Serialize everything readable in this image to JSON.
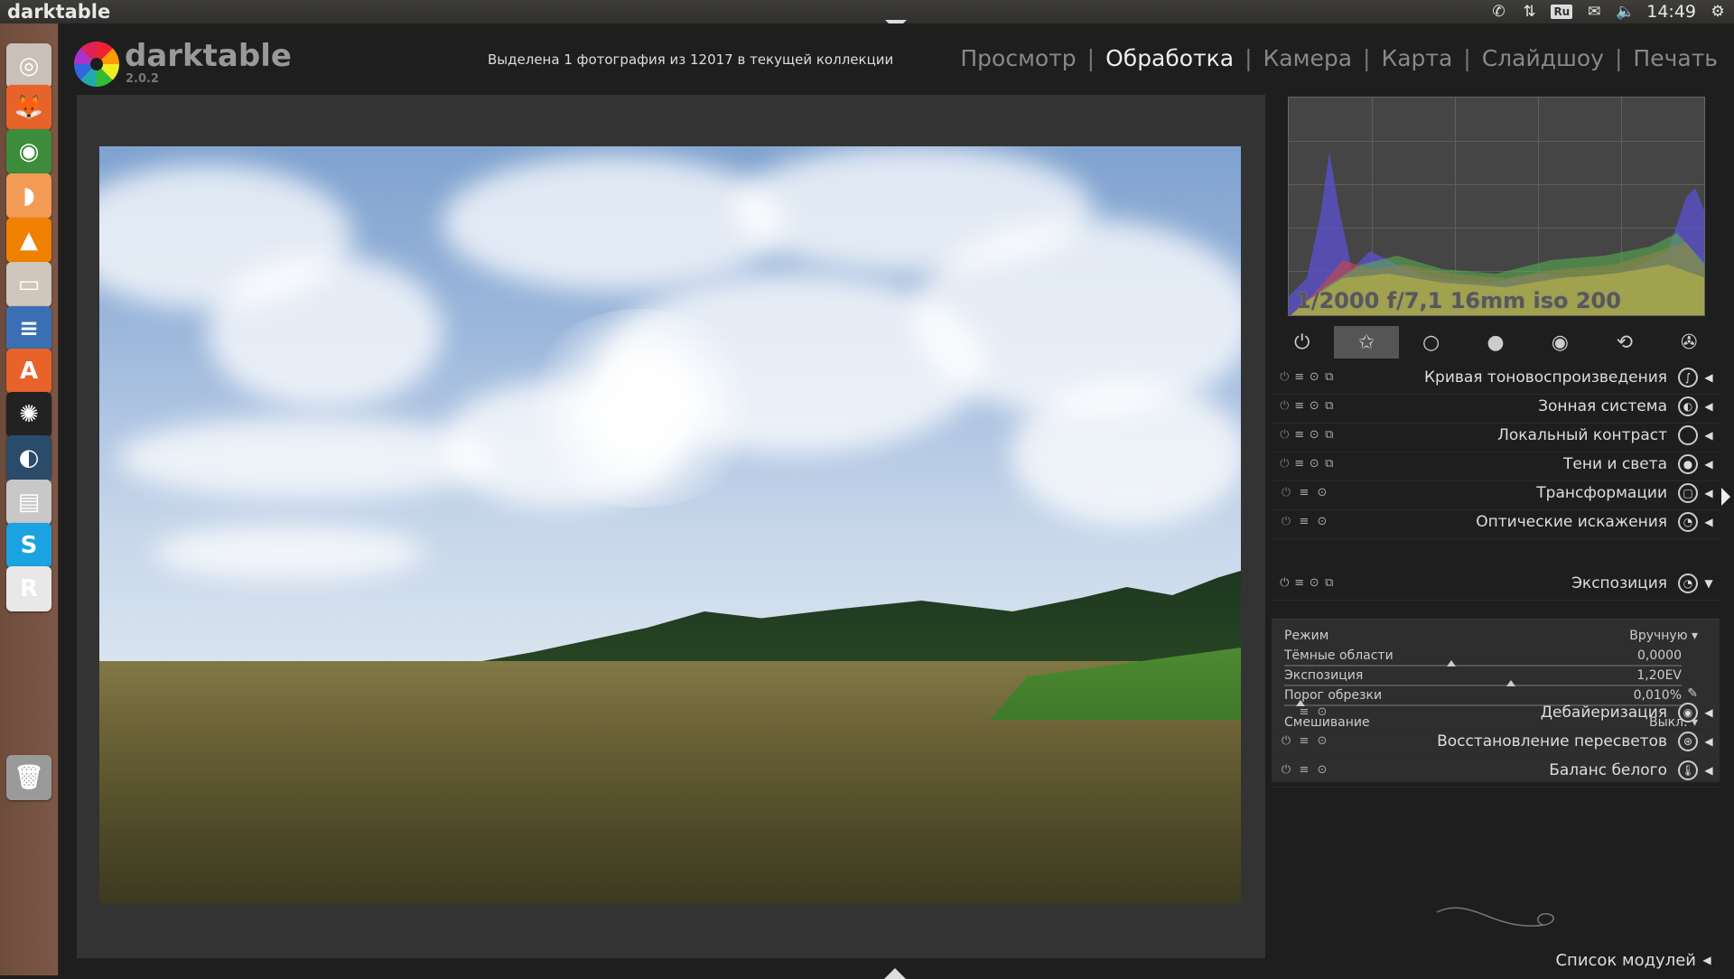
{
  "topbar": {
    "title": "darktable",
    "lang": "Ru",
    "clock": "14:49"
  },
  "launcher": {
    "items": [
      {
        "name": "ubuntu-home",
        "glyph": "◎",
        "color": "#c9c0b8"
      },
      {
        "name": "firefox",
        "glyph": "🦊",
        "color": "#e8632a"
      },
      {
        "name": "chrome",
        "glyph": "◉",
        "color": "#3c8c3c"
      },
      {
        "name": "peach",
        "glyph": "◗",
        "color": "#f39b55"
      },
      {
        "name": "vlc",
        "glyph": "▲",
        "color": "#f08000"
      },
      {
        "name": "files",
        "glyph": "▭",
        "color": "#cfc6bc"
      },
      {
        "name": "writer",
        "glyph": "≡",
        "color": "#3b6fb4"
      },
      {
        "name": "software-center",
        "glyph": "A",
        "color": "#e8632a"
      },
      {
        "name": "darktable",
        "glyph": "✺",
        "color": "#222222"
      },
      {
        "name": "steam",
        "glyph": "◐",
        "color": "#2b4b6a"
      },
      {
        "name": "scanner",
        "glyph": "▤",
        "color": "#c8c8c8"
      },
      {
        "name": "skype",
        "glyph": "S",
        "color": "#1aa3e0"
      },
      {
        "name": "rcmdr",
        "glyph": "R",
        "color": "#e8e8e8"
      },
      {
        "name": "trash",
        "glyph": "🗑",
        "color": "#9a9a9a"
      }
    ]
  },
  "app": {
    "name": "darktable",
    "version": "2.0.2",
    "status": "Выделена 1 фотография из 12017 в текущей коллекции"
  },
  "views": [
    "Просмотр",
    "Обработка",
    "Камера",
    "Карта",
    "Слайдшоу",
    "Печать"
  ],
  "active_view": "Обработка",
  "exif": "1/2000 f/7,1 16mm iso 200",
  "module_groups": [
    {
      "name": "active-group",
      "glyph": "⏻"
    },
    {
      "name": "favorites-group",
      "glyph": "✩"
    },
    {
      "name": "basic-group",
      "glyph": "○"
    },
    {
      "name": "tone-group",
      "glyph": "●"
    },
    {
      "name": "color-group",
      "glyph": "◉"
    },
    {
      "name": "correct-group",
      "glyph": "⟲"
    },
    {
      "name": "effects-group",
      "glyph": "✇"
    }
  ],
  "modules_top": [
    {
      "name": "Кривая тоновоспроизведения",
      "icon": "∫"
    },
    {
      "name": "Зонная система",
      "icon": "◐"
    },
    {
      "name": "Локальный контраст",
      "icon": ""
    },
    {
      "name": "Тени и света",
      "icon": "●"
    },
    {
      "name": "Трансформации",
      "icon": "▢"
    },
    {
      "name": "Оптические искажения",
      "icon": "◔"
    }
  ],
  "exposure": {
    "title": "Экспозиция",
    "mode_label": "Режим",
    "mode_value": "Вручную",
    "black_label": "Тёмные области",
    "black_value": "0,0000",
    "black_pos": 0.42,
    "exposure_label": "Экспозиция",
    "exposure_value": "1,20EV",
    "exposure_pos": 0.57,
    "clip_label": "Порог обрезки",
    "clip_value": "0,010%",
    "clip_pos": 0.04,
    "blend_label": "Смешивание",
    "blend_value": "Выкл."
  },
  "modules_bottom": [
    {
      "name": "Дебайеризация",
      "icon": "◉"
    },
    {
      "name": "Восстановление пересветов",
      "icon": "⊛"
    },
    {
      "name": "Баланс белого",
      "icon": "🌡"
    }
  ],
  "module_list_label": "Список модулей"
}
